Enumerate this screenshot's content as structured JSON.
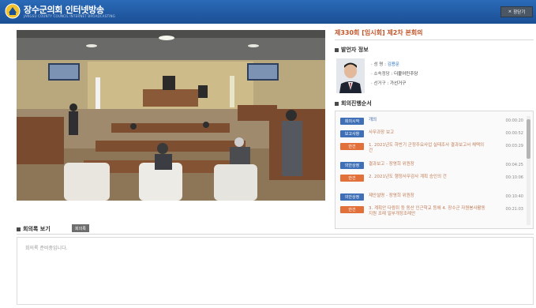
{
  "header": {
    "title": "장수군의회 인터넷방송",
    "subtitle": "JANGSU COUNTY COUNCIL INTERNET BROADCASTING",
    "close_label": "창닫기"
  },
  "session": {
    "title": "제330회 [임시회] 제2차 본회의"
  },
  "speaker": {
    "section_label": "발언자 정보",
    "fields": [
      {
        "key": "· 성 명 :",
        "value": "김용문"
      },
      {
        "key": "· 소속정당 :",
        "value": "더불어민주당"
      },
      {
        "key": "· 선거구 :",
        "value": "가선거구"
      }
    ]
  },
  "agenda": {
    "section_label": "회의진행순서",
    "items": [
      {
        "tag": "회의시작",
        "tag_color": "blue",
        "text": "개의",
        "time": "00:00:20"
      },
      {
        "tag": "보고사항",
        "tag_color": "blue",
        "text": "사무과장 보고",
        "time": "00:00:52"
      },
      {
        "tag": "안건",
        "tag_color": "orange",
        "text": "1. 2021년도 하반기 군정주요사업 실태조사 결과보고서 채택의 건",
        "time": "00:03:29"
      },
      {
        "tag": "의안상정",
        "tag_color": "blue",
        "text": "결과보고 - 장영희 위원장",
        "time": "00:04:25"
      },
      {
        "tag": "안건",
        "tag_color": "orange",
        "text": "2. 2021년도 행정사무감사 계획 승인의 건",
        "time": "00:10:06"
      },
      {
        "tag": "의안상정",
        "tag_color": "blue",
        "text": "제안설명 - 장영희 위원장",
        "time": "00:10:40"
      },
      {
        "tag": "안건",
        "tag_color": "orange",
        "text": "3. 계획안 다람쥐 등 동산 인근학교 등에 4. 장수군 자원봉사활동 지원 조례 일부개정조례안",
        "time": "00:21:03"
      }
    ]
  },
  "minutes": {
    "section_label": "회의록 보기",
    "button_label": "회의록",
    "content": "회의록 준비중입니다."
  },
  "colors": {
    "header_blue": "#1f5aa6",
    "accent_orange": "#e2703a",
    "tag_blue": "#3f6fb6"
  }
}
